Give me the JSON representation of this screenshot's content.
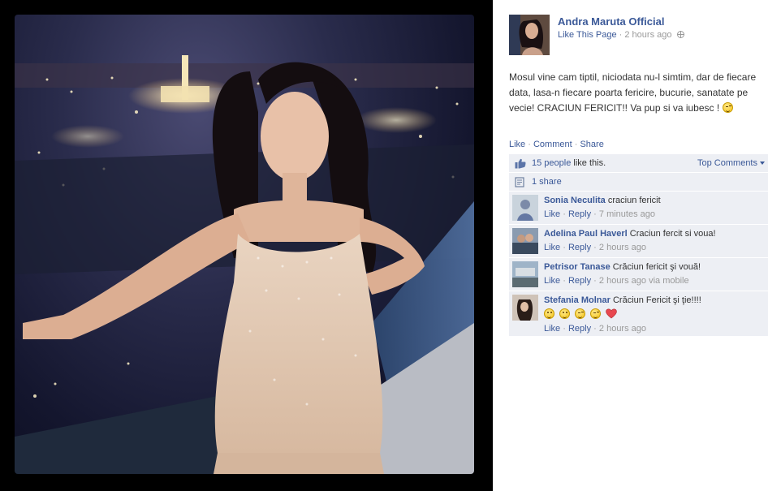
{
  "post": {
    "page_name": "Andra Maruta Official",
    "like_page": "Like This Page",
    "separator": "·",
    "time": "2 hours ago",
    "message": "Mosul vine cam tiptil, niciodata nu-l simtim, dar de fiecare data, lasa-n fiecare poarta fericire, bucurie, sanatate pe vecie! CRACIUN FERICIT!! Va pup si va iubesc !"
  },
  "actions": {
    "like": "Like",
    "comment": "Comment",
    "share": "Share"
  },
  "likes": {
    "count": "15 people",
    "suffix": "like this."
  },
  "sort": {
    "label": "Top Comments"
  },
  "shares": {
    "label": "1 share"
  },
  "comments": [
    {
      "name": "Sonia Neculita",
      "text": "craciun fericit",
      "like": "Like",
      "reply": "Reply",
      "time": "7 minutes ago",
      "via": ""
    },
    {
      "name": "Adelina Paul Haverl",
      "text": "Craciun fercit si voua!",
      "like": "Like",
      "reply": "Reply",
      "time": "2 hours ago",
      "via": ""
    },
    {
      "name": "Petrisor Tanase",
      "text": "Crăciun fericit şi vouă!",
      "like": "Like",
      "reply": "Reply",
      "time": "2 hours ago",
      "via": "via mobile"
    },
    {
      "name": "Stefania Molnar",
      "text": "Crăciun Fericit şi ţie!!!!",
      "like": "Like",
      "reply": "Reply",
      "time": "2 hours ago",
      "via": ""
    }
  ],
  "icons": {
    "globe": "globe-icon",
    "thumb": "thumbs-up-icon",
    "share": "share-icon",
    "emoticon": "smiley-icon",
    "heart": "heart-icon"
  },
  "colors": {
    "link": "#3b5998",
    "muted": "#999999",
    "ufi_bg": "#edeff4",
    "stage": "#000000"
  }
}
